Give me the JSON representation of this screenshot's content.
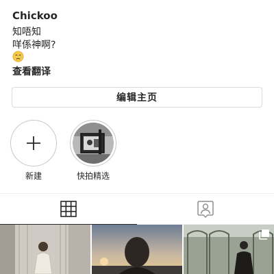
{
  "profile": {
    "username": "Chickoo",
    "bio_line1": "知唔知",
    "bio_line2": "咩係神啊?",
    "bio_emoji": "crying-face-emoji",
    "see_translation": "查看翻译"
  },
  "actions": {
    "edit_profile": "编辑主页"
  },
  "highlights": [
    {
      "label": "新建",
      "icon": "plus-icon"
    },
    {
      "label": "快拍精选",
      "icon": "story-thumbnail"
    }
  ],
  "tabs": [
    {
      "name": "grid",
      "icon": "grid-icon",
      "active": true
    },
    {
      "name": "tagged",
      "icon": "tagged-person-icon",
      "active": false
    }
  ],
  "posts": [
    {
      "icon": "photo-thumbnail"
    },
    {
      "icon": "photo-thumbnail"
    },
    {
      "icon": "photo-thumbnail",
      "badge": "multiple-photos-icon"
    }
  ],
  "colors": {
    "text": "#262626",
    "border": "#dbdbdb",
    "divider": "#efefef"
  }
}
